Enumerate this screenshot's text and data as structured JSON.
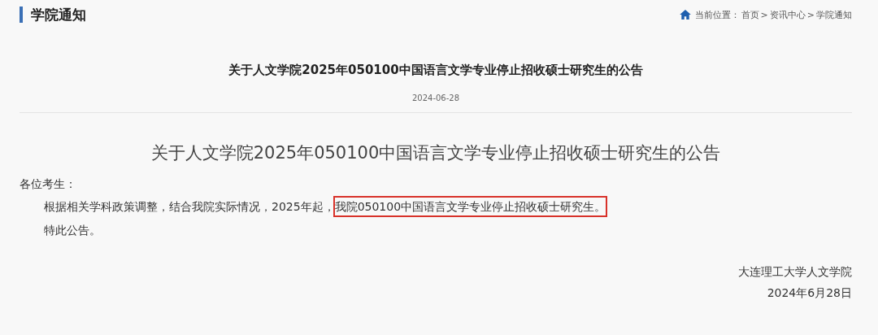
{
  "section_title": "学院通知",
  "breadcrumb": {
    "label": "当前位置：",
    "separator": ">",
    "items": [
      "首页",
      "资讯中心",
      "学院通知"
    ]
  },
  "article": {
    "title": "关于人文学院2025年050100中国语言文学专业停止招收硕士研究生的公告",
    "date": "2024-06-28",
    "heading": "关于人文学院2025年050100中国语言文学专业停止招收硕士研究生的公告",
    "salutation": "各位考生：",
    "paragraphs": [
      {
        "segments": [
          {
            "text": "根据相关学科政策调整，结合我院实际情况，2025年起，",
            "highlighted": false
          },
          {
            "text": "我院050100中国语言文学专业停止招收硕士研究生。",
            "highlighted": true
          }
        ]
      },
      {
        "segments": [
          {
            "text": "特此公告。",
            "highlighted": false
          }
        ]
      }
    ],
    "signature": "大连理工大学人文学院",
    "signed_date": "2024年6月28日"
  }
}
